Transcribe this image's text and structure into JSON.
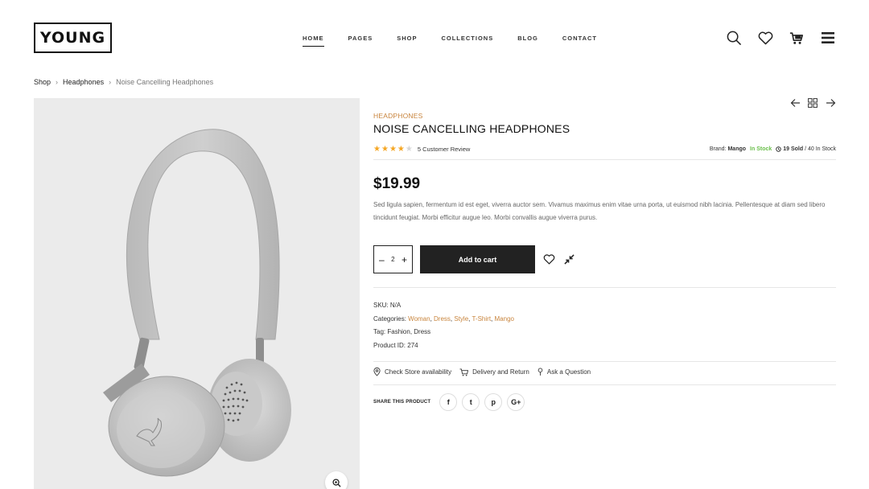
{
  "header": {
    "logo": "YOUNG",
    "nav": [
      "HOME",
      "PAGES",
      "SHOP",
      "COLLECTIONS",
      "BLOG",
      "CONTACT"
    ],
    "active_nav": "HOME",
    "icons": [
      "search-icon",
      "heart-icon",
      "cart-icon",
      "menu-icon"
    ]
  },
  "breadcrumb": {
    "items": [
      "Shop",
      "Headphones"
    ],
    "current": "Noise Cancelling Headphones"
  },
  "product": {
    "category": "HEADPHONES",
    "title": "NOISE CANCELLING HEADPHONES",
    "rating": 4,
    "rating_max": 5,
    "review_text": "5 Customer Review",
    "brand_label": "Brand:",
    "brand": "Mango",
    "stock": "In Stock",
    "sold": "19 Sold",
    "in_stock_count": "/ 40 In Stock",
    "price": "$19.99",
    "description": "Sed ligula sapien, fermentum id est eget, viverra auctor sem. Vivamus maximus enim vitae urna porta, ut euismod nibh lacinia. Pellentesque at diam sed libero tincidunt feugiat. Morbi efficitur augue leo. Morbi convallis augue viverra purus.",
    "quantity": "2",
    "add_to_cart": "Add to cart",
    "sku_label": "SKU:",
    "sku": "N/A",
    "categories_label": "Categories:",
    "categories": [
      "Woman",
      "Dress",
      "Style",
      "T-Shirt",
      "Mango"
    ],
    "tag_label": "Tag:",
    "tags": "Fashion, Dress",
    "id_label": "Product ID:",
    "id": "274"
  },
  "extra_links": [
    "Check Store availability",
    "Delivery and Return",
    "Ask a Question"
  ],
  "share": {
    "label": "SHARE THIS PRODUCT",
    "networks": [
      "f",
      "t",
      "p",
      "G+"
    ]
  },
  "colors": {
    "accent": "#c8843c",
    "in_stock": "#6abf4b",
    "star": "#f5a623",
    "button": "#222222",
    "image_bg": "#ebebeb"
  }
}
